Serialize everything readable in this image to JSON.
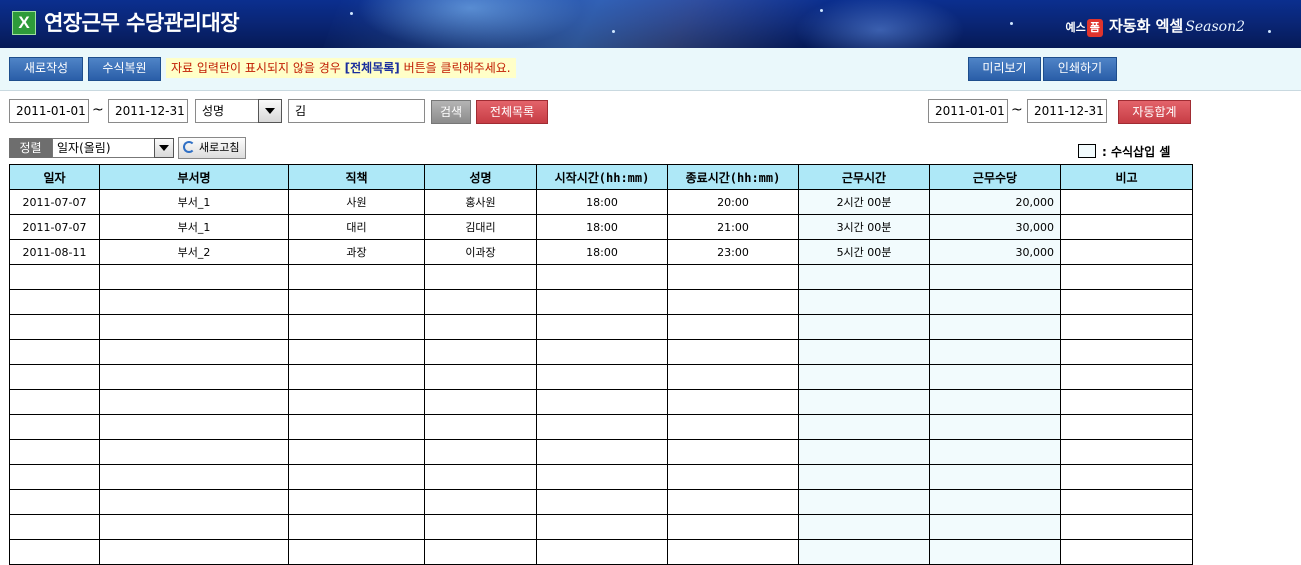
{
  "header": {
    "app_icon_letter": "X",
    "title": "연장근무 수당관리대장",
    "brand": {
      "prefix": "예스",
      "badge": "폼",
      "name": "자동화 엑셀",
      "season": "Season2"
    }
  },
  "toolbar": {
    "new_label": "새로작성",
    "restore_label": "수식복원",
    "notice_before": "자료 입력란이 표시되지  않을 경우 ",
    "notice_highlight": "[전체목록]",
    "notice_after": " 버튼을 클릭해주세요.",
    "preview_label": "미리보기",
    "print_label": "인쇄하기"
  },
  "filters": {
    "date_from": "2011-01-01",
    "date_to": "2011-12-31",
    "tilde": "~",
    "field_select": "성명",
    "keyword": "김",
    "search_label": "검색",
    "all_list_label": "전체목록",
    "sum_date_from": "2011-01-01",
    "sum_date_to": "2011-12-31",
    "auto_sum_label": "자동합계"
  },
  "sort": {
    "label": "정렬",
    "selected": "일자(올림)",
    "refresh_label": "새로고침"
  },
  "legend": {
    "label": ": 수식삽입 셀"
  },
  "table": {
    "columns": [
      "일자",
      "부서명",
      "직책",
      "성명",
      "시작시간(hh:mm)",
      "종료시간(hh:mm)",
      "근무시간",
      "근무수당",
      "비고"
    ],
    "rows": [
      [
        "2011-07-07",
        "부서_1",
        "사원",
        "홍사원",
        "18:00",
        "20:00",
        "2시간 00분",
        "20,000",
        ""
      ],
      [
        "2011-07-07",
        "부서_1",
        "대리",
        "김대리",
        "18:00",
        "21:00",
        "3시간 00분",
        "30,000",
        ""
      ],
      [
        "2011-08-11",
        "부서_2",
        "과장",
        "이과장",
        "18:00",
        "23:00",
        "5시간 00분",
        "30,000",
        ""
      ]
    ],
    "empty_rows": 12
  }
}
